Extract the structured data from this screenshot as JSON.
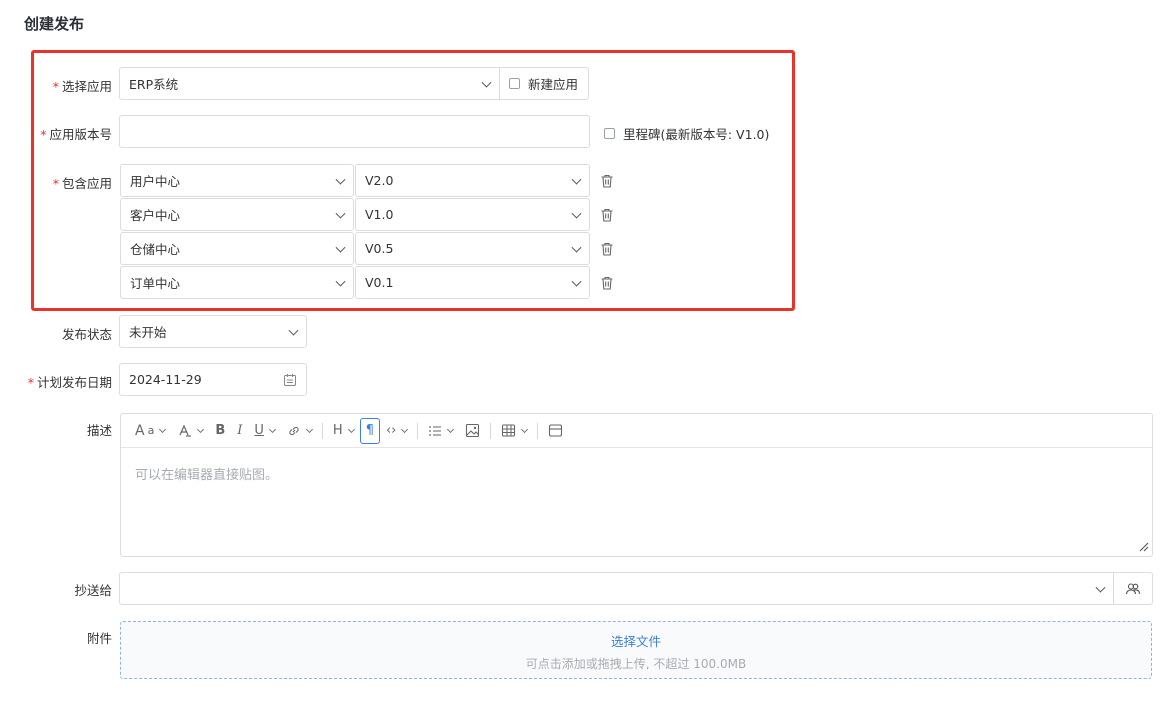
{
  "page": {
    "title": "创建发布"
  },
  "form": {
    "app": {
      "label": "选择应用",
      "value": "ERP系统",
      "new_app_label": "新建应用"
    },
    "version": {
      "label": "应用版本号",
      "value": "",
      "milestone_label": "里程碑(最新版本号: V1.0)"
    },
    "included": {
      "label": "包含应用",
      "rows": [
        {
          "app": "用户中心",
          "version": "V2.0"
        },
        {
          "app": "客户中心",
          "version": "V1.0"
        },
        {
          "app": "仓储中心",
          "version": "V0.5"
        },
        {
          "app": "订单中心",
          "version": "V0.1"
        }
      ]
    },
    "status": {
      "label": "发布状态",
      "value": "未开始"
    },
    "date": {
      "label": "计划发布日期",
      "value": "2024-11-29"
    },
    "description": {
      "label": "描述",
      "placeholder": "可以在编辑器直接贴图。"
    },
    "cc": {
      "label": "抄送给",
      "value": ""
    },
    "attachment": {
      "label": "附件",
      "select_label": "选择文件",
      "hint": "可点击添加或拖拽上传, 不超过 100.0MB"
    }
  },
  "colors": {
    "required": "#e8332a",
    "highlight": "#e8332a",
    "link": "#3b7fe0"
  },
  "toolbar_icons": [
    "font-size-icon",
    "text-color-icon",
    "bold-icon",
    "italic-icon",
    "underline-icon",
    "link-icon",
    "heading-icon",
    "paragraph-icon",
    "code-icon",
    "list-icon",
    "image-icon",
    "table-icon",
    "embed-icon"
  ]
}
